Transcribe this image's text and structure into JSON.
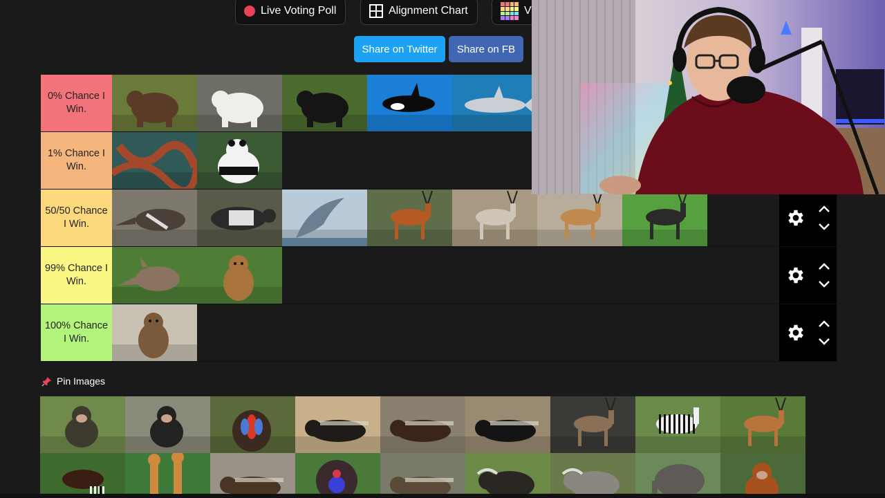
{
  "nav": {
    "live_voting": "Live Voting Poll",
    "alignment": "Alignment Chart",
    "partial": "Vi"
  },
  "share": {
    "twitter": "Share on Twitter",
    "facebook": "Share on FB"
  },
  "tiers": [
    {
      "label": "0% Chance I Win.",
      "color": "#f2737a",
      "items": [
        "grizzly-bear",
        "polar-bear",
        "black-bear",
        "orca",
        "great-white-shark"
      ]
    },
    {
      "label": "1% Chance I Win.",
      "color": "#f5b67d",
      "items": [
        "octopus",
        "giant-panda"
      ]
    },
    {
      "label": "50/50 Chance I Win.",
      "color": "#fcd97d",
      "items": [
        "giant-anteater",
        "tapir",
        "dolphin",
        "bongo",
        "oryx",
        "gazelle",
        "blackbuck"
      ]
    },
    {
      "label": "99% Chance I Win.",
      "color": "#fbf784",
      "items": [
        "aardvark",
        "prairie-dog"
      ]
    },
    {
      "label": "100% Chance I Win.",
      "color": "#b3f47c",
      "items": [
        "groundhog"
      ]
    }
  ],
  "pin": {
    "label": "Pin Images"
  },
  "pool": [
    "gibbons",
    "chimpanzee",
    "mandrill",
    "honey-badger",
    "wolverine",
    "tasmanian-devil",
    "deer",
    "zebra",
    "axis-deer",
    "okapi",
    "giraffes",
    "mink",
    "turkey",
    "otter",
    "cape-buffalo",
    "rhinoceros",
    "elephant",
    "orangutan"
  ]
}
